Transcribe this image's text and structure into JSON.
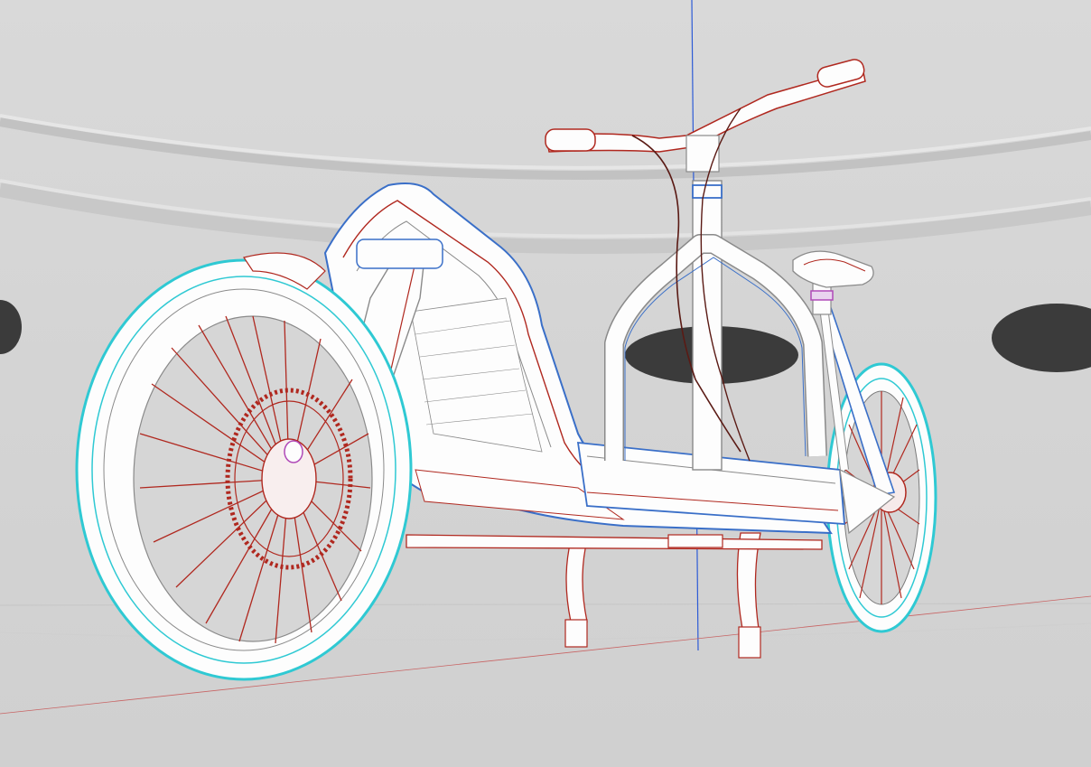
{
  "scene": {
    "kind": "3d-viewport-wireframe",
    "subject": "cargo-bike",
    "background_color": "#d6d6d6",
    "floor_color": "#d2d2d2",
    "holes_color": "#3b3b3b",
    "colors": {
      "mesh_fill": "#fdfdfd",
      "mesh_line": "#8a8a8a",
      "edge_red": "#b0281f",
      "edge_blue": "#3a6fc8",
      "edge_cyan": "#2fc9d3",
      "edge_magenta": "#b04ab8",
      "axis_blue": "#2d5bd6",
      "axis_red": "#c86464"
    }
  }
}
